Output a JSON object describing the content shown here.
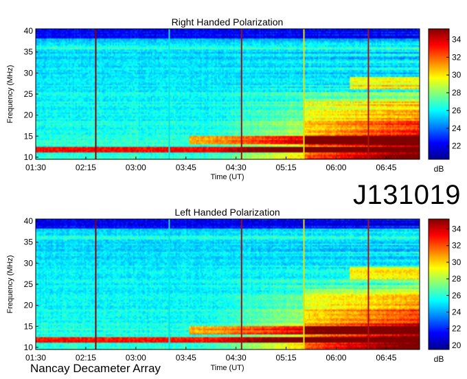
{
  "figure": {
    "observation_id": "J131019",
    "instrument": "Nancay Decameter Array"
  },
  "chart_data": [
    {
      "type": "heatmap",
      "title": "Right Handed Polarization",
      "xlabel": "Time (UT)",
      "ylabel": "Frequency (MHz)",
      "x_ticks": [
        "01:30",
        "02:15",
        "03:00",
        "03:45",
        "04:30",
        "05:15",
        "06:00",
        "06:45"
      ],
      "x_tick_minutes": [
        90,
        135,
        180,
        225,
        270,
        315,
        360,
        405
      ],
      "xlim_minutes": [
        90,
        435
      ],
      "y_ticks": [
        10,
        15,
        20,
        25,
        30,
        35,
        40
      ],
      "ylim": [
        9.5,
        40.5
      ],
      "colorbar": {
        "label": "dB",
        "ticks": [
          22,
          24,
          26,
          28,
          30,
          32,
          34
        ],
        "range": [
          20.5,
          35.2
        ]
      },
      "vertical_markers": [
        {
          "time": "02:24",
          "minutes": 144,
          "color": "#8b0000"
        },
        {
          "time": "03:30",
          "minutes": 210,
          "color": "#00e5e5"
        },
        {
          "time": "04:35",
          "minutes": 275,
          "color": "#a01010"
        },
        {
          "time": "05:31",
          "minutes": 331,
          "color": "#e8e000"
        },
        {
          "time": "06:29",
          "minutes": 389,
          "color": "#b01010"
        }
      ]
    },
    {
      "type": "heatmap",
      "title": "Left Handed Polarization",
      "xlabel": "Time (UT)",
      "ylabel": "Frequency (MHz)",
      "x_ticks": [
        "01:30",
        "02:15",
        "03:00",
        "03:45",
        "04:30",
        "05:15",
        "06:00",
        "06:45"
      ],
      "x_tick_minutes": [
        90,
        135,
        180,
        225,
        270,
        315,
        360,
        405
      ],
      "xlim_minutes": [
        90,
        435
      ],
      "y_ticks": [
        10,
        15,
        20,
        25,
        30,
        35,
        40
      ],
      "ylim": [
        9.5,
        40.5
      ],
      "colorbar": {
        "label": "dB",
        "ticks": [
          20,
          22,
          24,
          26,
          28,
          30,
          32,
          34
        ],
        "range": [
          19.5,
          35.2
        ]
      },
      "vertical_markers": [
        {
          "time": "02:24",
          "minutes": 144,
          "color": "#8b0000"
        },
        {
          "time": "03:30",
          "minutes": 210,
          "color": "#00e5e5"
        },
        {
          "time": "04:35",
          "minutes": 275,
          "color": "#a01010"
        },
        {
          "time": "05:31",
          "minutes": 331,
          "color": "#e8e000"
        },
        {
          "time": "06:29",
          "minutes": 389,
          "color": "#b01010"
        }
      ]
    }
  ]
}
